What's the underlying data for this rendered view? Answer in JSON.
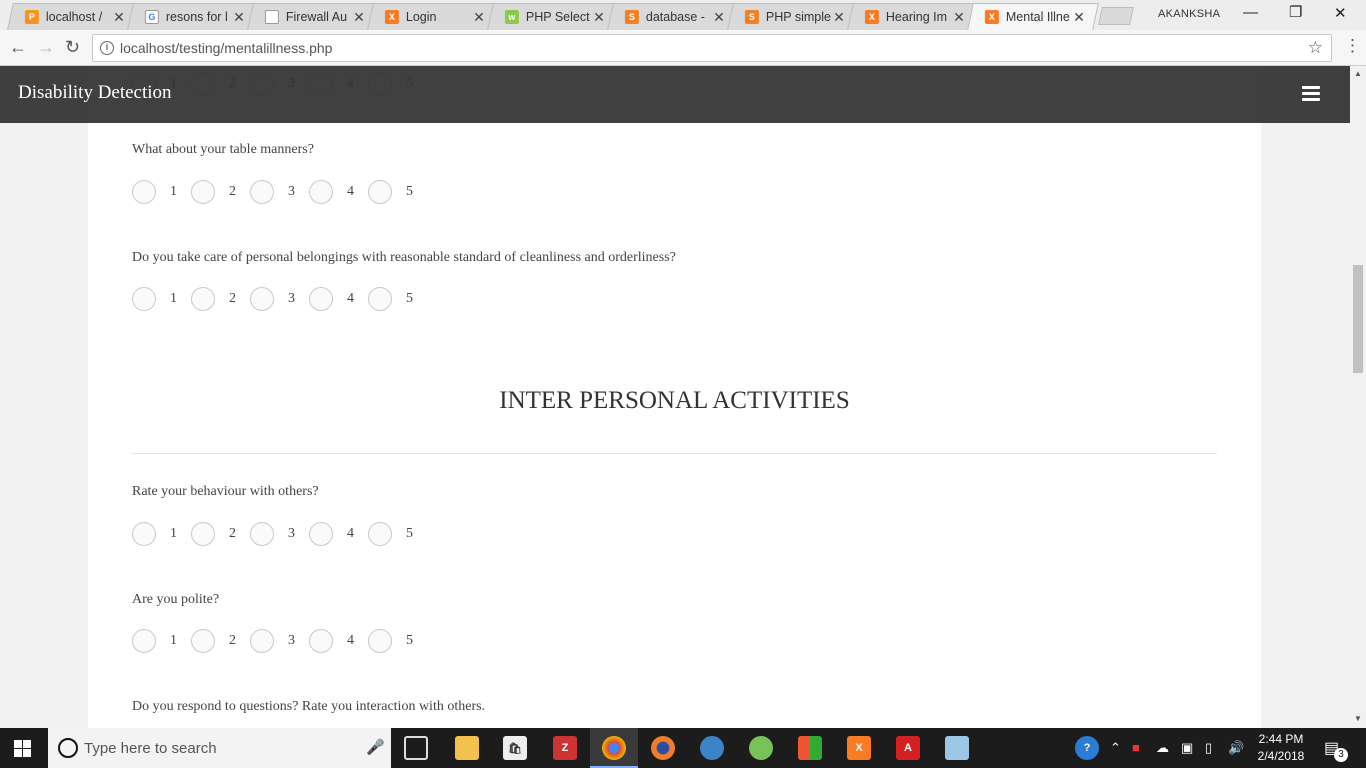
{
  "browser": {
    "tabs": [
      {
        "title": "localhost /",
        "fav_color": "#f7931e",
        "fav_text": "P"
      },
      {
        "title": "resons for l",
        "fav_color": "#ffffff",
        "fav_text": "G"
      },
      {
        "title": "Firewall Au",
        "fav_color": "#ffffff",
        "fav_text": ""
      },
      {
        "title": "Login",
        "fav_color": "#fb7a24",
        "fav_text": "X"
      },
      {
        "title": "PHP Select",
        "fav_color": "#8cc84b",
        "fav_text": "w"
      },
      {
        "title": "database -",
        "fav_color": "#f48024",
        "fav_text": "S"
      },
      {
        "title": "PHP simple",
        "fav_color": "#f48024",
        "fav_text": "S"
      },
      {
        "title": "Hearing Im",
        "fav_color": "#fb7a24",
        "fav_text": "X"
      },
      {
        "title": "Mental Illne",
        "fav_color": "#fb7a24",
        "fav_text": "X"
      }
    ],
    "profile_name": "AKANKSHA",
    "url": "localhost/testing/mentalillness.php"
  },
  "app": {
    "brand": "Disability Detection"
  },
  "form": {
    "options": [
      "1",
      "2",
      "3",
      "4",
      "5"
    ],
    "q_table_manners": "What about your table manners?",
    "q_belongings": "Do you take care of personal belongings with reasonable standard of cleanliness and orderliness?",
    "section_interpersonal": "INTER PERSONAL ACTIVITIES",
    "q_behaviour": "Rate your behaviour with others?",
    "q_polite": "Are you polite?",
    "q_respond": "Do you respond to questions? Rate you interaction with others."
  },
  "taskbar": {
    "search_placeholder": "Type here to search",
    "time": "2:44 PM",
    "date": "2/4/2018",
    "notification_count": "3"
  }
}
